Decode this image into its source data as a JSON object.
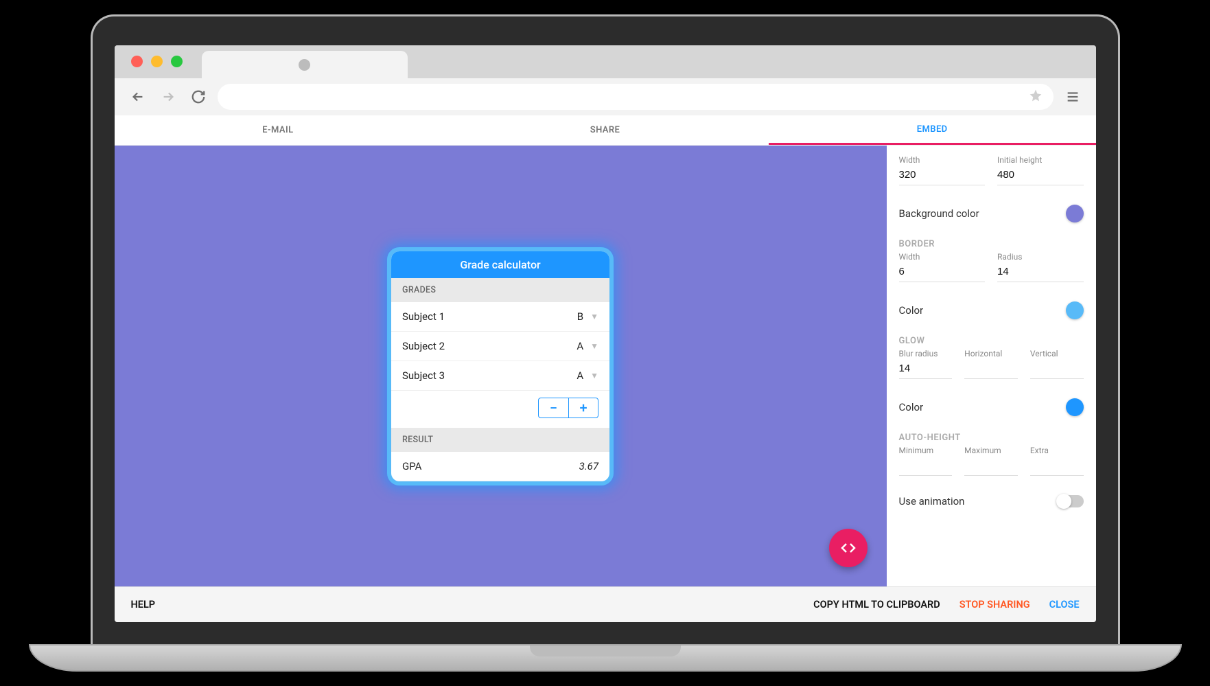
{
  "colors": {
    "preview_bg": "#7b7bd6",
    "border_color": "#58baf8",
    "glow_color": "#1e96ff",
    "pink": "#e91e63",
    "orange": "#ff5722"
  },
  "app_tabs": {
    "email": "E-MAIL",
    "share": "SHARE",
    "embed": "EMBED"
  },
  "widget": {
    "title": "Grade calculator",
    "grades_label": "GRADES",
    "subjects": [
      {
        "name": "Subject 1",
        "grade": "B"
      },
      {
        "name": "Subject 2",
        "grade": "A"
      },
      {
        "name": "Subject 3",
        "grade": "A"
      }
    ],
    "result_label": "RESULT",
    "gpa_label": "GPA",
    "gpa_value": "3.67"
  },
  "settings": {
    "width_label": "Width",
    "width_value": "320",
    "initial_height_label": "Initial height",
    "initial_height_value": "480",
    "bg_color_label": "Background color",
    "bg_color_value": "#7b7bd6",
    "border_group": "BORDER",
    "border_width_label": "Width",
    "border_width_value": "6",
    "border_radius_label": "Radius",
    "border_radius_value": "14",
    "border_color_label": "Color",
    "border_color_value": "#58baf8",
    "glow_group": "GLOW",
    "glow_blur_label": "Blur radius",
    "glow_blur_value": "14",
    "glow_h_label": "Horizontal",
    "glow_h_value": "",
    "glow_v_label": "Vertical",
    "glow_v_value": "",
    "glow_color_label": "Color",
    "glow_color_value": "#1e96ff",
    "autoheight_group": "AUTO-HEIGHT",
    "ah_min_label": "Minimum",
    "ah_min_value": "",
    "ah_max_label": "Maximum",
    "ah_max_value": "",
    "ah_extra_label": "Extra",
    "ah_extra_value": "",
    "use_animation_label": "Use animation"
  },
  "footer": {
    "help": "HELP",
    "copy": "COPY HTML TO CLIPBOARD",
    "stop": "STOP SHARING",
    "close": "CLOSE"
  }
}
